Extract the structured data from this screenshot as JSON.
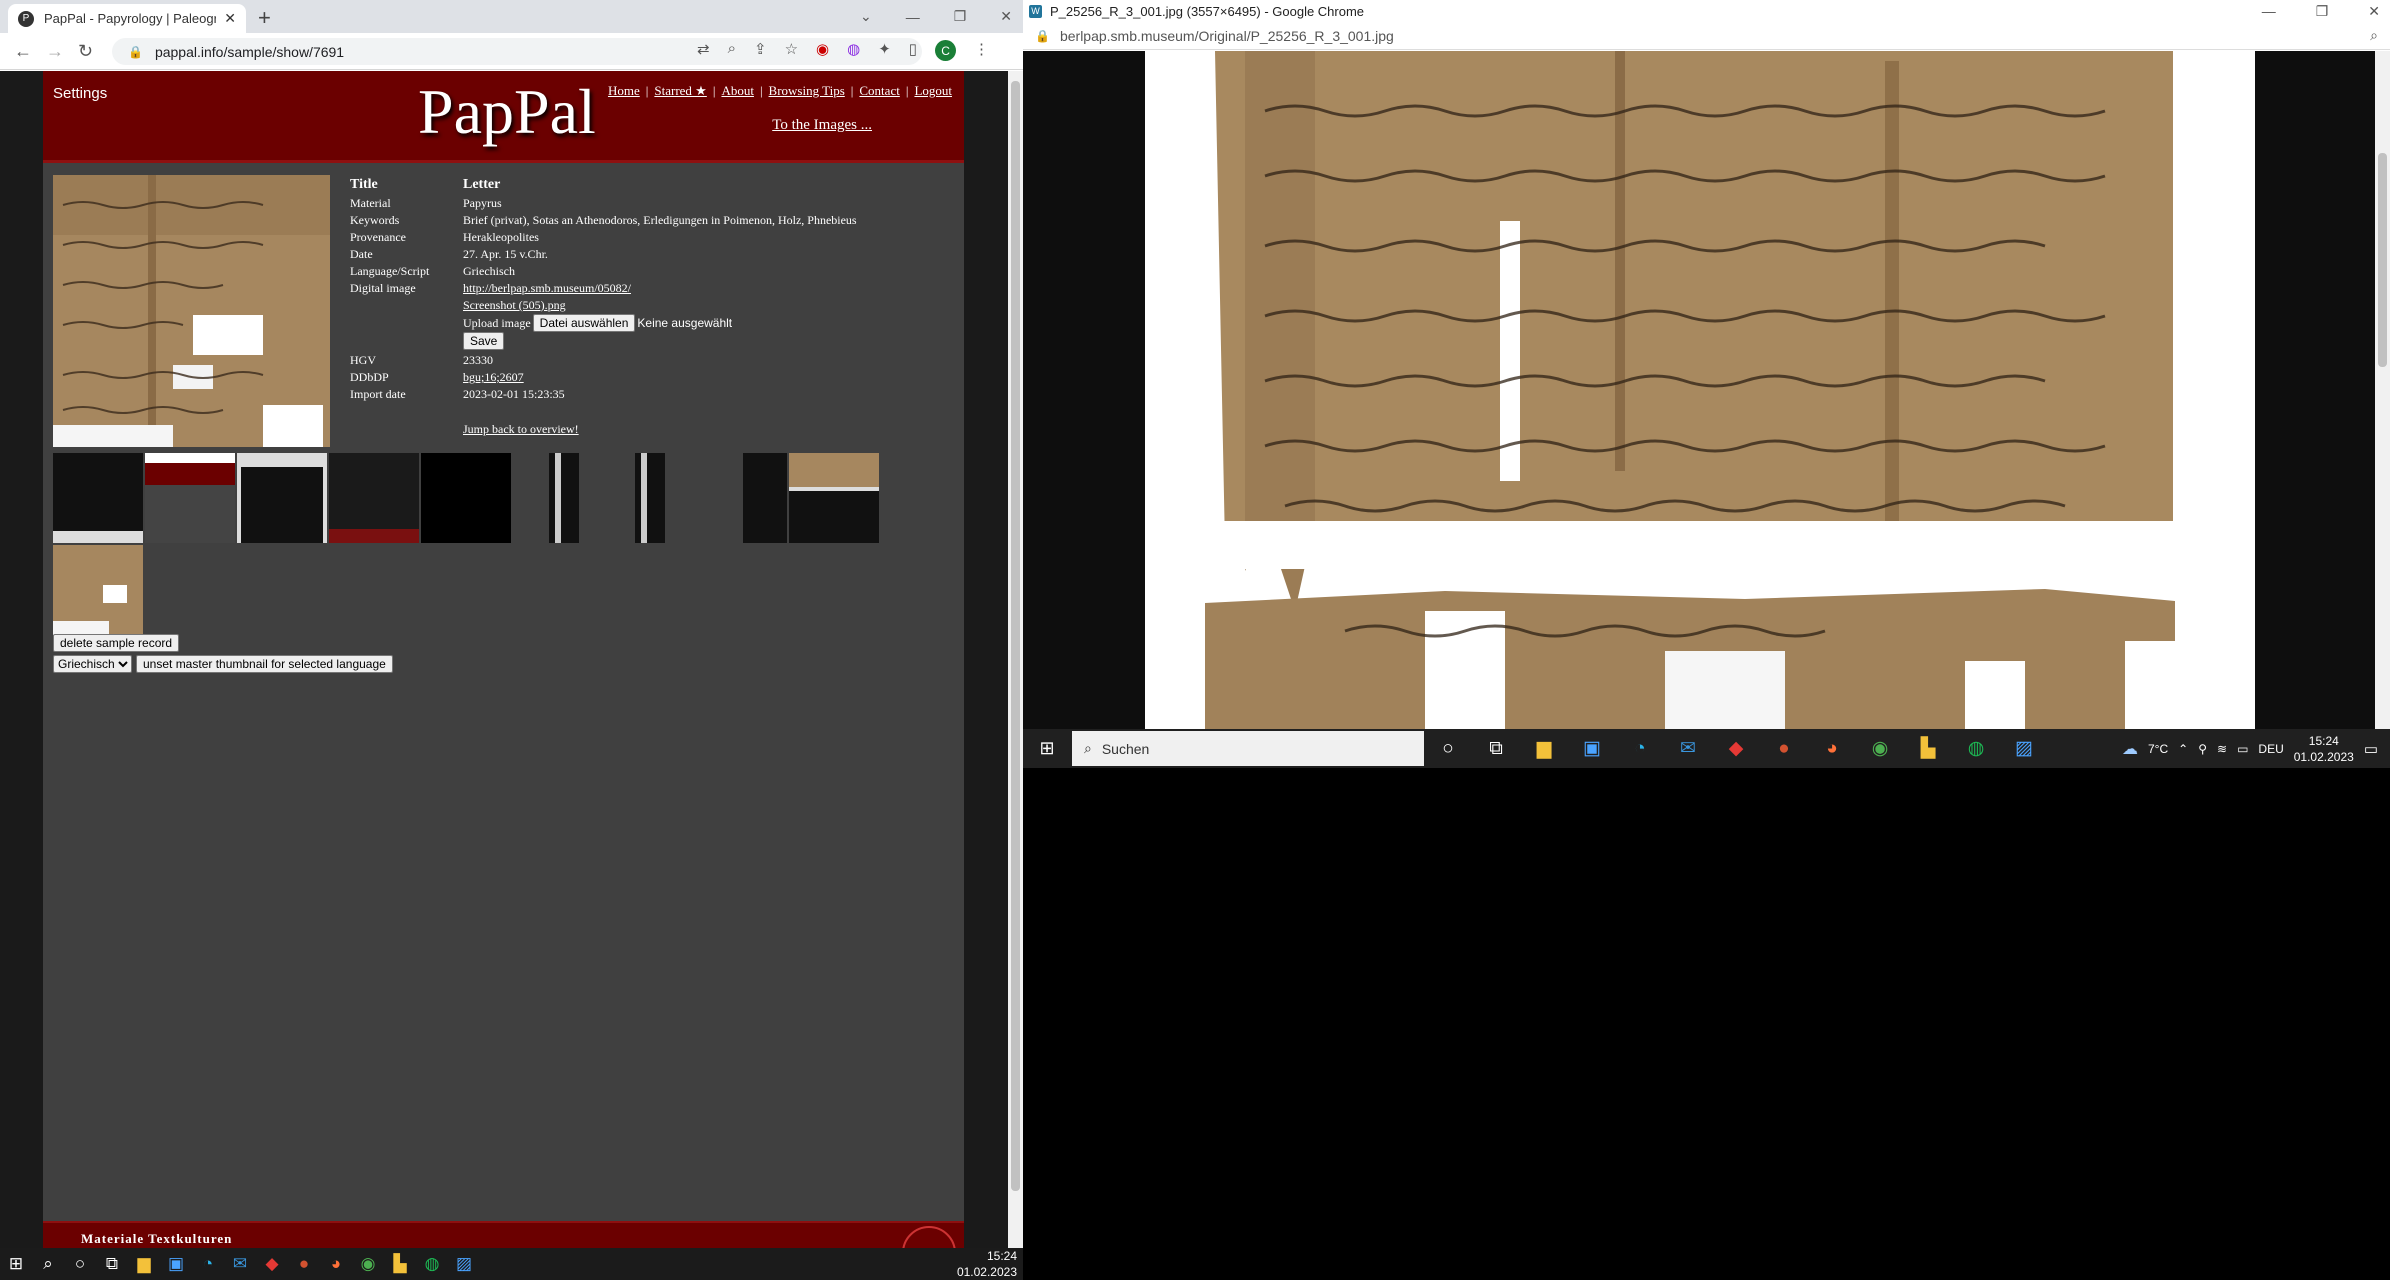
{
  "left_browser": {
    "tab_title": "PapPal - Papyrology | Paleograph",
    "url": "pappal.info/sample/show/7691",
    "profile_initial": "C"
  },
  "site": {
    "settings_label": "Settings",
    "logo": "PapPal",
    "nav": [
      "Home",
      "Starred ★",
      "About",
      "Browsing Tips",
      "Contact",
      "Logout"
    ],
    "separator": "|",
    "to_images": "To the Images ...",
    "fields": [
      {
        "label": "Title",
        "value": "Letter"
      },
      {
        "label": "Material",
        "value": "Papyrus"
      },
      {
        "label": "Keywords",
        "value": "Brief (privat), Sotas an Athenodoros, Erledigungen in Poimenon, Holz, Phnebieus"
      },
      {
        "label": "Provenance",
        "value": "Herakleopolites"
      },
      {
        "label": "Date",
        "value": "27. Apr. 15 v.Chr."
      },
      {
        "label": "Language/Script",
        "value": "Griechisch"
      },
      {
        "label": "Digital image",
        "value": "http://berlpap.smb.museum/05082/"
      }
    ],
    "screenshot_link": "Screenshot (505).png",
    "upload_label": "Upload image",
    "file_button": "Datei auswählen",
    "no_file": "Keine ausgewählt",
    "save_button": "Save",
    "hgv_label": "HGV",
    "hgv_value": "23330",
    "ddbdp_label": "DDbDP",
    "ddbdp_value": "bgu;16;2607",
    "import_label": "Import date",
    "import_value": "2023-02-01 15:23:35",
    "jump_back": "Jump back to overview!",
    "delete_button": "delete sample record",
    "language_select": "Griechisch",
    "unset_button": "unset master thumbnail for selected language",
    "footer_text": "Materiale Textkulturen"
  },
  "left_taskbar": {
    "time": "15:24",
    "date": "01.02.2023"
  },
  "right_browser": {
    "title": "P_25256_R_3_001.jpg (3557×6495) - Google Chrome",
    "url": "berlpap.smb.museum/Original/P_25256_R_3_001.jpg"
  },
  "right_taskbar": {
    "search_placeholder": "Suchen",
    "temperature": "7°C",
    "language": "DEU",
    "time": "15:24",
    "date": "01.02.2023"
  }
}
